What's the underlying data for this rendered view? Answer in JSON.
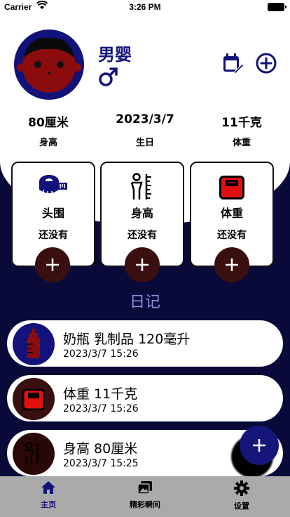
{
  "status_bar": {
    "carrier": "Carrier",
    "time": "3:26 PM"
  },
  "profile": {
    "name": "男婴",
    "gender_symbol": "♂"
  },
  "stats": [
    {
      "value": "80厘米",
      "label": "身高"
    },
    {
      "value": "2023/3/7",
      "label": "生日"
    },
    {
      "value": "11千克",
      "label": "体重"
    }
  ],
  "cards": [
    {
      "title": "头围",
      "value": "还没有",
      "icon": "tape-measure-icon"
    },
    {
      "title": "身高",
      "value": "还没有",
      "icon": "height-ruler-icon"
    },
    {
      "title": "体重",
      "value": "还没有",
      "icon": "scale-icon"
    }
  ],
  "diary": {
    "title": "日记",
    "entries": [
      {
        "text": "奶瓶 乳制品 120毫升",
        "time": "2023/3/7 15:26",
        "icon": "bottle-icon"
      },
      {
        "text": "体重  11千克",
        "time": "2023/3/7 15:26",
        "icon": "scale-icon"
      },
      {
        "text": "身高  80厘米",
        "time": "2023/3/7 15:25",
        "icon": "height-ruler-icon"
      }
    ]
  },
  "tabs": [
    {
      "label": "主页",
      "icon": "home-icon",
      "active": true
    },
    {
      "label": "精彩瞬间",
      "icon": "photos-icon",
      "active": false
    },
    {
      "label": "设置",
      "icon": "gear-icon",
      "active": false
    }
  ],
  "colors": {
    "navy": "#12127a",
    "background": "#0a0a3a",
    "red": "#e01010",
    "dark_red": "#3a0f0f",
    "diary_title": "#8a8fd8",
    "tab_active": "#12127a"
  }
}
